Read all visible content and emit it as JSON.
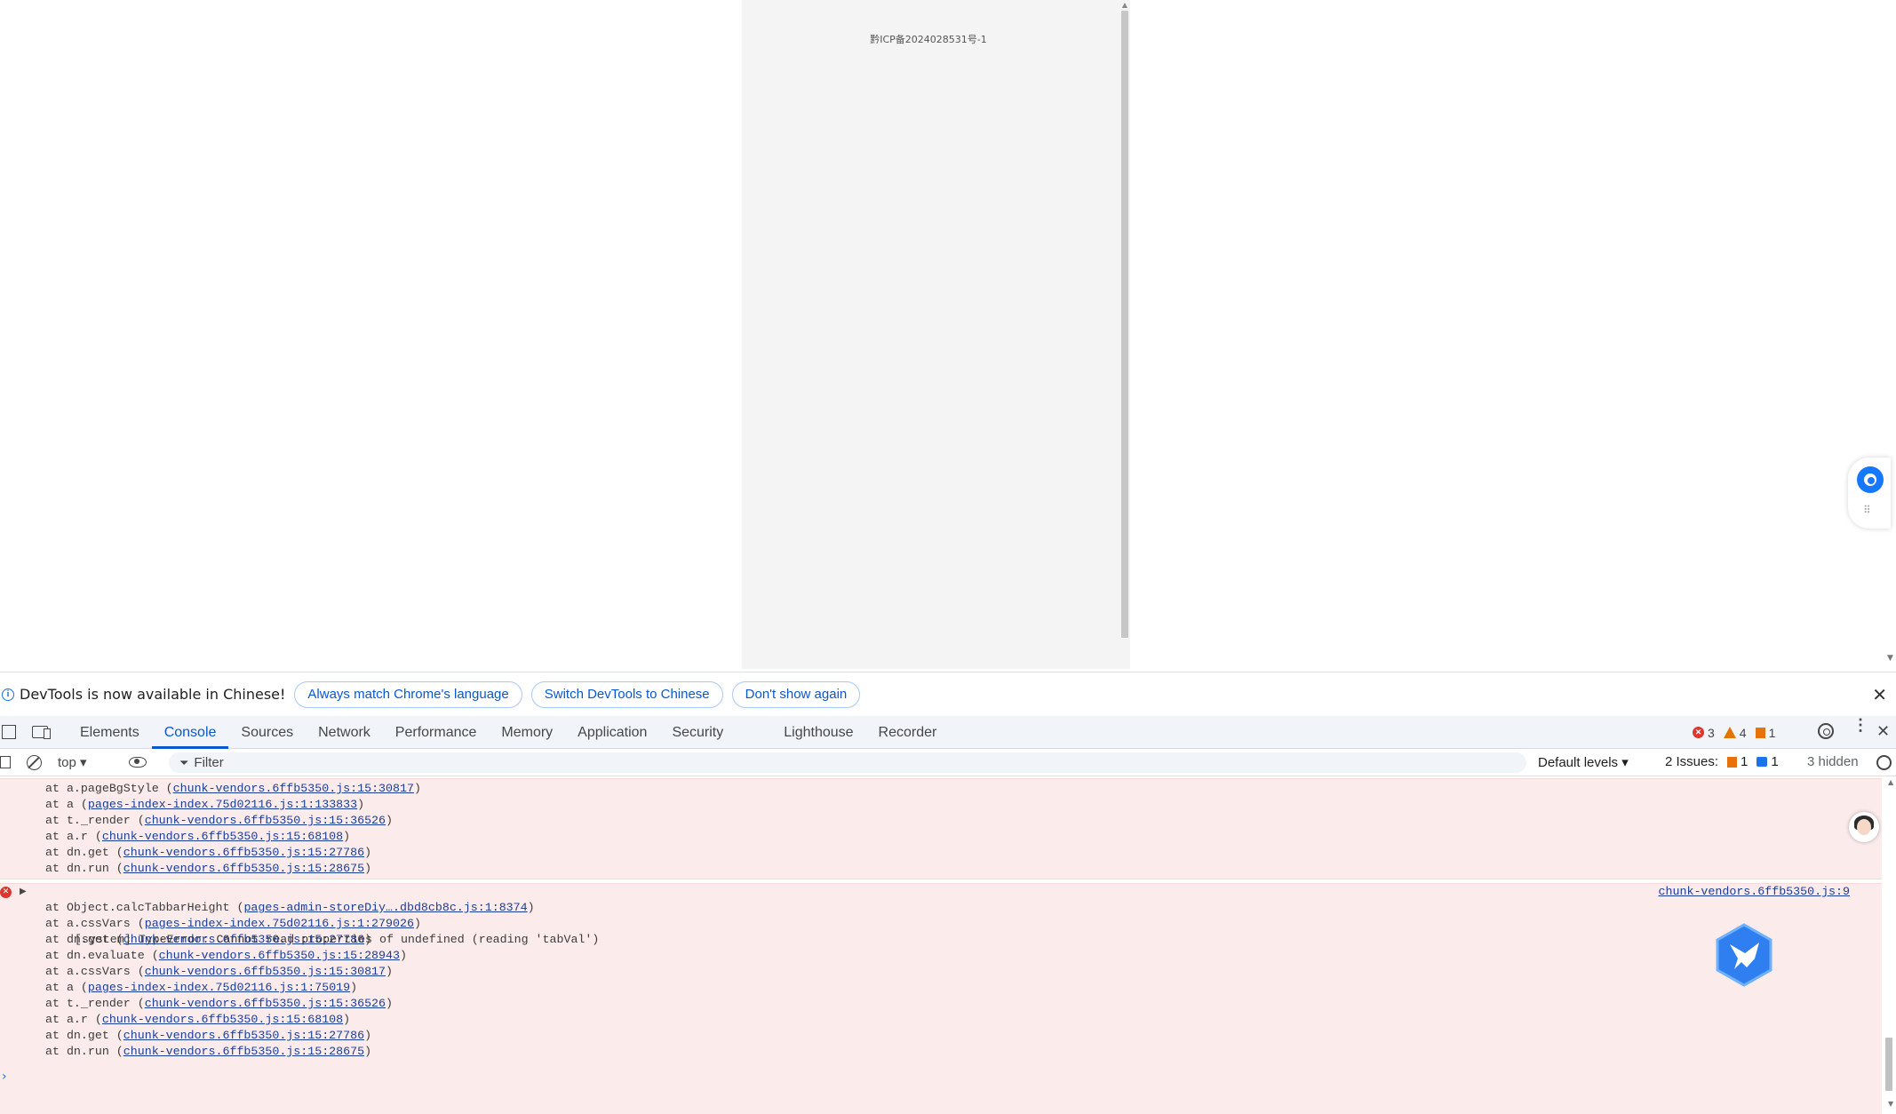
{
  "page": {
    "icp_text": "黔ICP备2024028531号-1"
  },
  "infobar": {
    "message": "DevTools is now available in Chinese!",
    "btn_match": "Always match Chrome's language",
    "btn_switch": "Switch DevTools to Chinese",
    "btn_dismiss": "Don't show again",
    "close": "✕"
  },
  "tabs": {
    "items": [
      "Elements",
      "Console",
      "Sources",
      "Network",
      "Performance",
      "Memory",
      "Application",
      "Security",
      "Lighthouse",
      "Recorder"
    ],
    "active": "Console",
    "error_count": "3",
    "warning_count": "4",
    "issue_count": "1"
  },
  "toolbar": {
    "context": "top ▾",
    "filter_placeholder": "Filter",
    "levels": "Default levels ▾",
    "issues_label": "2 Issues:",
    "issues_flag_count": "1",
    "issues_msg_count": "1",
    "hidden": "3 hidden"
  },
  "console": {
    "msg1_stack": [
      {
        "prefix": "at a.pageBgStyle (",
        "link": "chunk-vendors.6ffb5350.js:15:30817",
        "suffix": ")"
      },
      {
        "prefix": "at a (",
        "link": "pages-index-index.75d02116.js:1:133833",
        "suffix": ")"
      },
      {
        "prefix": "at t._render (",
        "link": "chunk-vendors.6ffb5350.js:15:36526",
        "suffix": ")"
      },
      {
        "prefix": "at a.r (",
        "link": "chunk-vendors.6ffb5350.js:15:68108",
        "suffix": ")"
      },
      {
        "prefix": "at dn.get (",
        "link": "chunk-vendors.6ffb5350.js:15:27786",
        "suffix": ")"
      },
      {
        "prefix": "at dn.run (",
        "link": "chunk-vendors.6ffb5350.js:15:28675",
        "suffix": ")"
      }
    ],
    "msg2_head": "[system] TypeError: Cannot read properties of undefined (reading 'tabVal')",
    "msg2_source": "chunk-vendors.6ffb5350.js:9",
    "msg2_stack": [
      {
        "prefix": "at Object.calcTabbarHeight (",
        "link": "pages-admin-storeDiy….dbd8cb8c.js:1:8374",
        "suffix": ")"
      },
      {
        "prefix": "at a.cssVars (",
        "link": "pages-index-index.75d02116.js:1:279026",
        "suffix": ")"
      },
      {
        "prefix": "at dn.get (",
        "link": "chunk-vendors.6ffb5350.js:15:27786",
        "suffix": ")"
      },
      {
        "prefix": "at dn.evaluate (",
        "link": "chunk-vendors.6ffb5350.js:15:28943",
        "suffix": ")"
      },
      {
        "prefix": "at a.cssVars (",
        "link": "chunk-vendors.6ffb5350.js:15:30817",
        "suffix": ")"
      },
      {
        "prefix": "at a (",
        "link": "pages-index-index.75d02116.js:1:75019",
        "suffix": ")"
      },
      {
        "prefix": "at t._render (",
        "link": "chunk-vendors.6ffb5350.js:15:36526",
        "suffix": ")"
      },
      {
        "prefix": "at a.r (",
        "link": "chunk-vendors.6ffb5350.js:15:68108",
        "suffix": ")"
      },
      {
        "prefix": "at dn.get (",
        "link": "chunk-vendors.6ffb5350.js:15:27786",
        "suffix": ")"
      },
      {
        "prefix": "at dn.run (",
        "link": "chunk-vendors.6ffb5350.js:15:28675",
        "suffix": ")"
      }
    ],
    "prompt": "›"
  },
  "colors": {
    "accent": "#0b57d0",
    "error_bg": "#fcebeb",
    "error_icon": "#dc362e",
    "warning": "#e37400"
  }
}
